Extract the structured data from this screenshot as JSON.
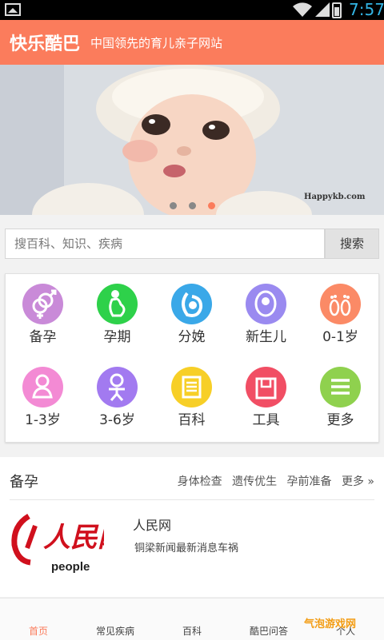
{
  "statusbar": {
    "time": "7:57"
  },
  "app": {
    "title": "快乐酷巴",
    "subtitle": "中国领先的育儿亲子网站",
    "accent": "#fb7c5c"
  },
  "banner": {
    "watermark": "Happykb.com",
    "active_dot": 3,
    "dot_count": 3
  },
  "search": {
    "placeholder": "搜百科、知识、疾病",
    "value": "",
    "button": "搜索"
  },
  "categories": [
    {
      "label": "备孕",
      "icon": "gender-icon",
      "color": "#c98ad8"
    },
    {
      "label": "孕期",
      "icon": "pregnant-icon",
      "color": "#2ed14a"
    },
    {
      "label": "分娩",
      "icon": "birth-icon",
      "color": "#3aa8e8"
    },
    {
      "label": "新生儿",
      "icon": "newborn-icon",
      "color": "#9a8af0"
    },
    {
      "label": "0-1岁",
      "icon": "footprint-icon",
      "color": "#fb8a66"
    },
    {
      "label": "1-3岁",
      "icon": "toddler-icon",
      "color": "#f38ad4"
    },
    {
      "label": "3-6岁",
      "icon": "child-icon",
      "color": "#a27af0"
    },
    {
      "label": "百科",
      "icon": "book-icon",
      "color": "#f7cf27"
    },
    {
      "label": "工具",
      "icon": "toolbox-icon",
      "color": "#f14e64"
    },
    {
      "label": "更多",
      "icon": "menu-icon",
      "color": "#8fd14e"
    }
  ],
  "section": {
    "title": "备孕",
    "links": [
      "身体检查",
      "遗传优生",
      "孕前准备",
      "更多 »"
    ],
    "news": {
      "title": "人民网",
      "desc": "铜梁新闻最新消息车祸",
      "logo_text": "people"
    }
  },
  "bottom_tabs": [
    "首页",
    "常见疾病",
    "百科",
    "酷巴问答",
    "个人"
  ],
  "active_tab": 0,
  "footer_watermark": "气泡游戏网"
}
